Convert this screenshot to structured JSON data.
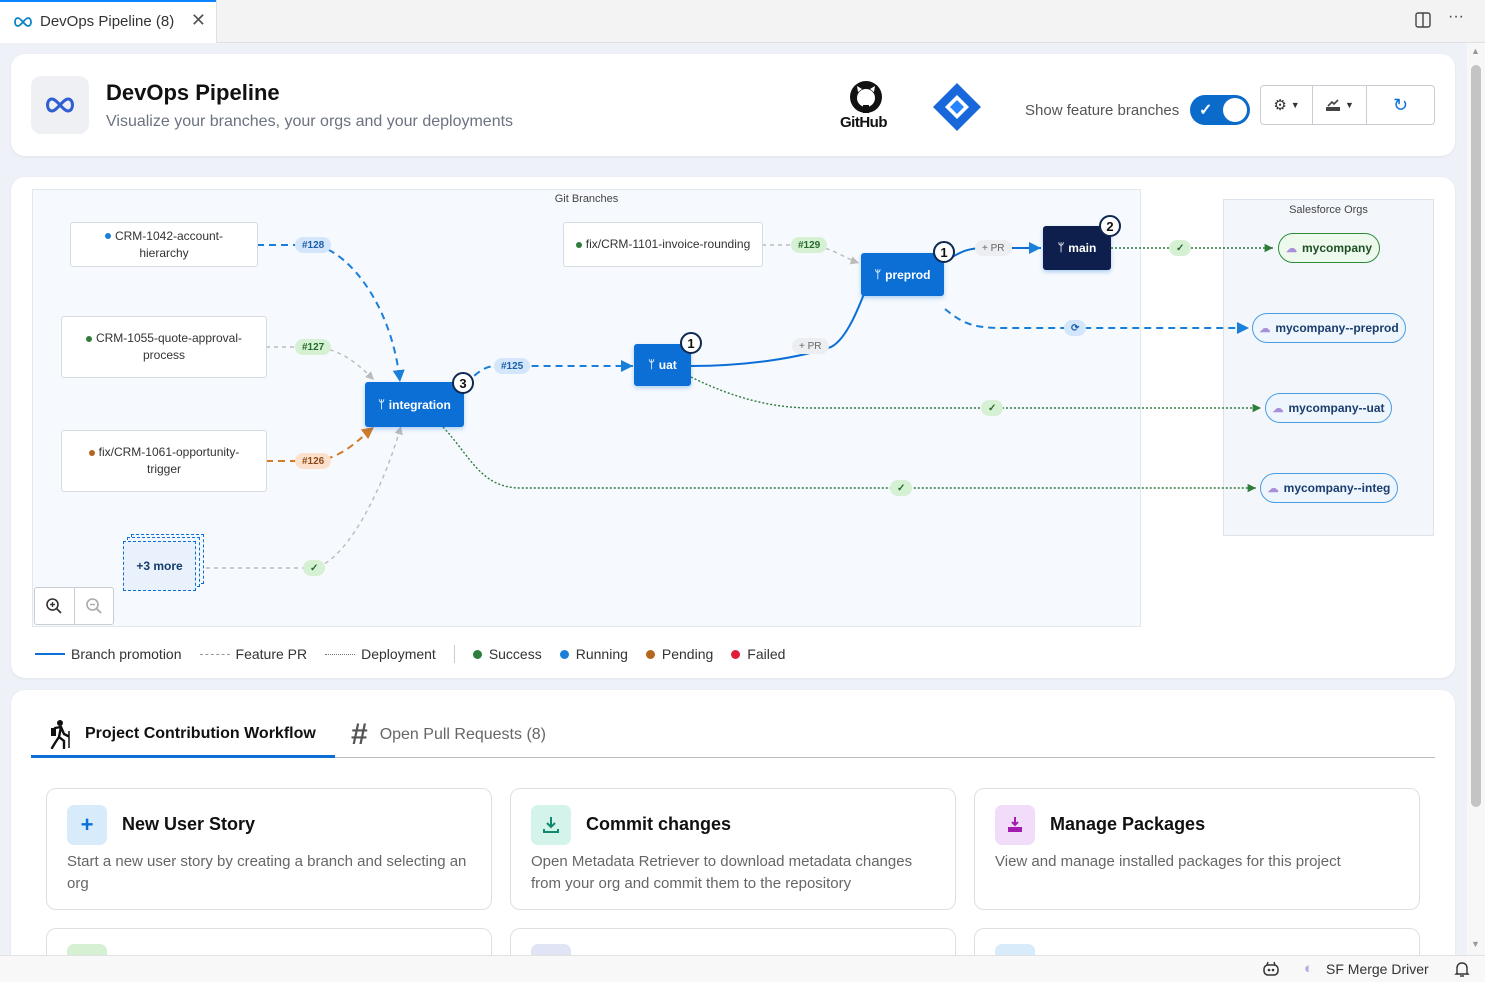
{
  "tab": {
    "title": "DevOps Pipeline (8)",
    "close": "✕"
  },
  "window": {
    "split_icon": "split-editor-icon",
    "more_label": "···"
  },
  "header": {
    "title": "DevOps Pipeline",
    "subtitle": "Visualize your branches, your orgs and your deployments",
    "github_label": "GitHub",
    "toggle_label": "Show feature branches",
    "toggle_on": true
  },
  "diagram": {
    "git_area_title": "Git Branches",
    "orgs_area_title": "Salesforce Orgs",
    "feature_branches": [
      {
        "name": "CRM-1042-account-hierarchy",
        "status": "running"
      },
      {
        "name": "CRM-1055-quote-approval-process",
        "status": "success"
      },
      {
        "name": "fix/CRM-1061-opportunity-trigger",
        "status": "pending"
      },
      {
        "name": "fix/CRM-1101-invoice-rounding",
        "status": "success"
      }
    ],
    "more_label": "+3 more",
    "prs": {
      "p128": "#128",
      "p127": "#127",
      "p126": "#126",
      "p129": "#129",
      "p125": "#125",
      "check": "✓",
      "pr_label": "+ PR",
      "running": "⟳"
    },
    "nodes": {
      "integration": {
        "label": "integration",
        "badge": "3"
      },
      "uat": {
        "label": "uat",
        "badge": "1"
      },
      "preprod": {
        "label": "preprod",
        "badge": "1"
      },
      "main": {
        "label": "main",
        "badge": "2"
      }
    },
    "orgs": [
      "mycompany",
      "mycompany--preprod",
      "mycompany--uat",
      "mycompany--integ"
    ]
  },
  "legend": {
    "branch_promotion": "Branch promotion",
    "feature_pr": "Feature PR",
    "deployment": "Deployment",
    "success": "Success",
    "running": "Running",
    "pending": "Pending",
    "failed": "Failed"
  },
  "colors": {
    "success": "#2e7d3a",
    "running": "#1a7fd8",
    "pending": "#b5651d",
    "failed": "#e11d3b",
    "accent": "#0b6fd6",
    "main_node": "#0e1f4d"
  },
  "workflow": {
    "tabs": [
      {
        "label": "Project Contribution Workflow",
        "icon": "hiker-icon",
        "active": true
      },
      {
        "label": "Open Pull Requests (8)",
        "icon": "hash-icon",
        "active": false
      }
    ],
    "cards": [
      {
        "title": "New User Story",
        "desc": "Start a new user story by creating a branch and selecting an org",
        "icon": "plus-icon"
      },
      {
        "title": "Commit changes",
        "desc": "Open Metadata Retriever to download metadata changes from your org and commit them to the repository",
        "icon": "download-icon"
      },
      {
        "title": "Manage Packages",
        "desc": "View and manage installed packages for this project",
        "icon": "package-icon"
      }
    ]
  },
  "statusbar": {
    "extension": "SF Merge Driver"
  }
}
